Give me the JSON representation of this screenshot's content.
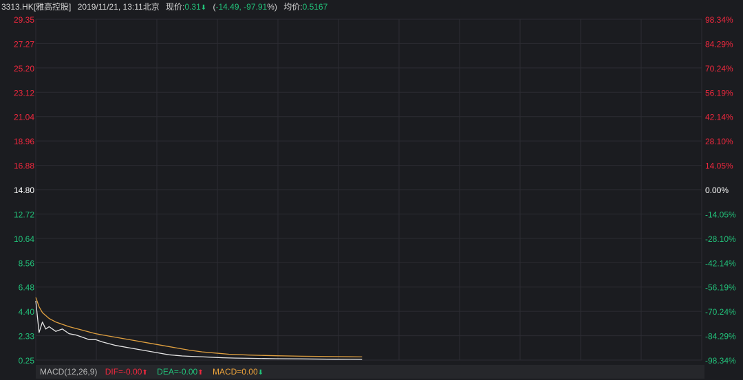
{
  "header": {
    "symbol": "3313.HK[雅高控股]",
    "datetime": "2019/11/21, 13:11北京",
    "price_label": "现价:",
    "price": "0.31",
    "change_open": "(",
    "change": "-14.49, -97.91",
    "change_close": "%)",
    "avg_label": "均价:",
    "avg_price": "0.5167",
    "price_arrow_icon": "arrow-down"
  },
  "colors": {
    "background": "#1b1c20",
    "grid": "#2c2d33",
    "up": "#f0283e",
    "down": "#22c27a",
    "neutral": "#ffffff",
    "price_line": "#e6e6e6",
    "avg_line": "#e0a040"
  },
  "chart_data": {
    "type": "line",
    "ylim": [
      0.25,
      29.35
    ],
    "left_ticks": [
      "29.35",
      "27.27",
      "25.20",
      "23.12",
      "21.04",
      "18.96",
      "16.88",
      "14.80",
      "12.72",
      "10.64",
      "8.56",
      "6.48",
      "4.40",
      "2.33",
      "0.25"
    ],
    "right_ticks": [
      "98.34%",
      "84.29%",
      "70.24%",
      "56.19%",
      "42.14%",
      "28.10%",
      "14.05%",
      "0.00%",
      "-14.05%",
      "-28.10%",
      "-42.14%",
      "-56.19%",
      "-70.24%",
      "-84.29%",
      "-98.34%"
    ],
    "reference_price": 14.8,
    "x_session_fraction": [
      0,
      0.49
    ],
    "series": [
      {
        "key": "price",
        "x": [
          0,
          0.005,
          0.01,
          0.015,
          0.02,
          0.03,
          0.04,
          0.05,
          0.06,
          0.07,
          0.08,
          0.09,
          0.1,
          0.12,
          0.14,
          0.16,
          0.18,
          0.2,
          0.22,
          0.24,
          0.26,
          0.28,
          0.3,
          0.32,
          0.36,
          0.4,
          0.45,
          0.49
        ],
        "y": [
          5.3,
          2.6,
          3.5,
          2.9,
          3.1,
          2.7,
          2.9,
          2.5,
          2.4,
          2.2,
          2.0,
          2.0,
          1.8,
          1.5,
          1.3,
          1.1,
          0.9,
          0.7,
          0.6,
          0.55,
          0.5,
          0.45,
          0.42,
          0.4,
          0.37,
          0.35,
          0.32,
          0.31
        ]
      },
      {
        "key": "average",
        "x": [
          0,
          0.005,
          0.01,
          0.02,
          0.03,
          0.05,
          0.07,
          0.09,
          0.11,
          0.13,
          0.15,
          0.17,
          0.19,
          0.21,
          0.23,
          0.25,
          0.27,
          0.29,
          0.32,
          0.36,
          0.4,
          0.45,
          0.49
        ],
        "y": [
          5.6,
          4.8,
          4.3,
          3.8,
          3.5,
          3.1,
          2.8,
          2.5,
          2.3,
          2.1,
          1.9,
          1.7,
          1.5,
          1.3,
          1.1,
          0.95,
          0.85,
          0.75,
          0.68,
          0.62,
          0.58,
          0.55,
          0.52
        ]
      }
    ],
    "grid": true
  },
  "macd": {
    "label": "MACD(12,26,9)",
    "dif_label": "DIF=-0.00",
    "dea_label": "DEA=-0.00",
    "macd_label": "MACD=0.00"
  }
}
